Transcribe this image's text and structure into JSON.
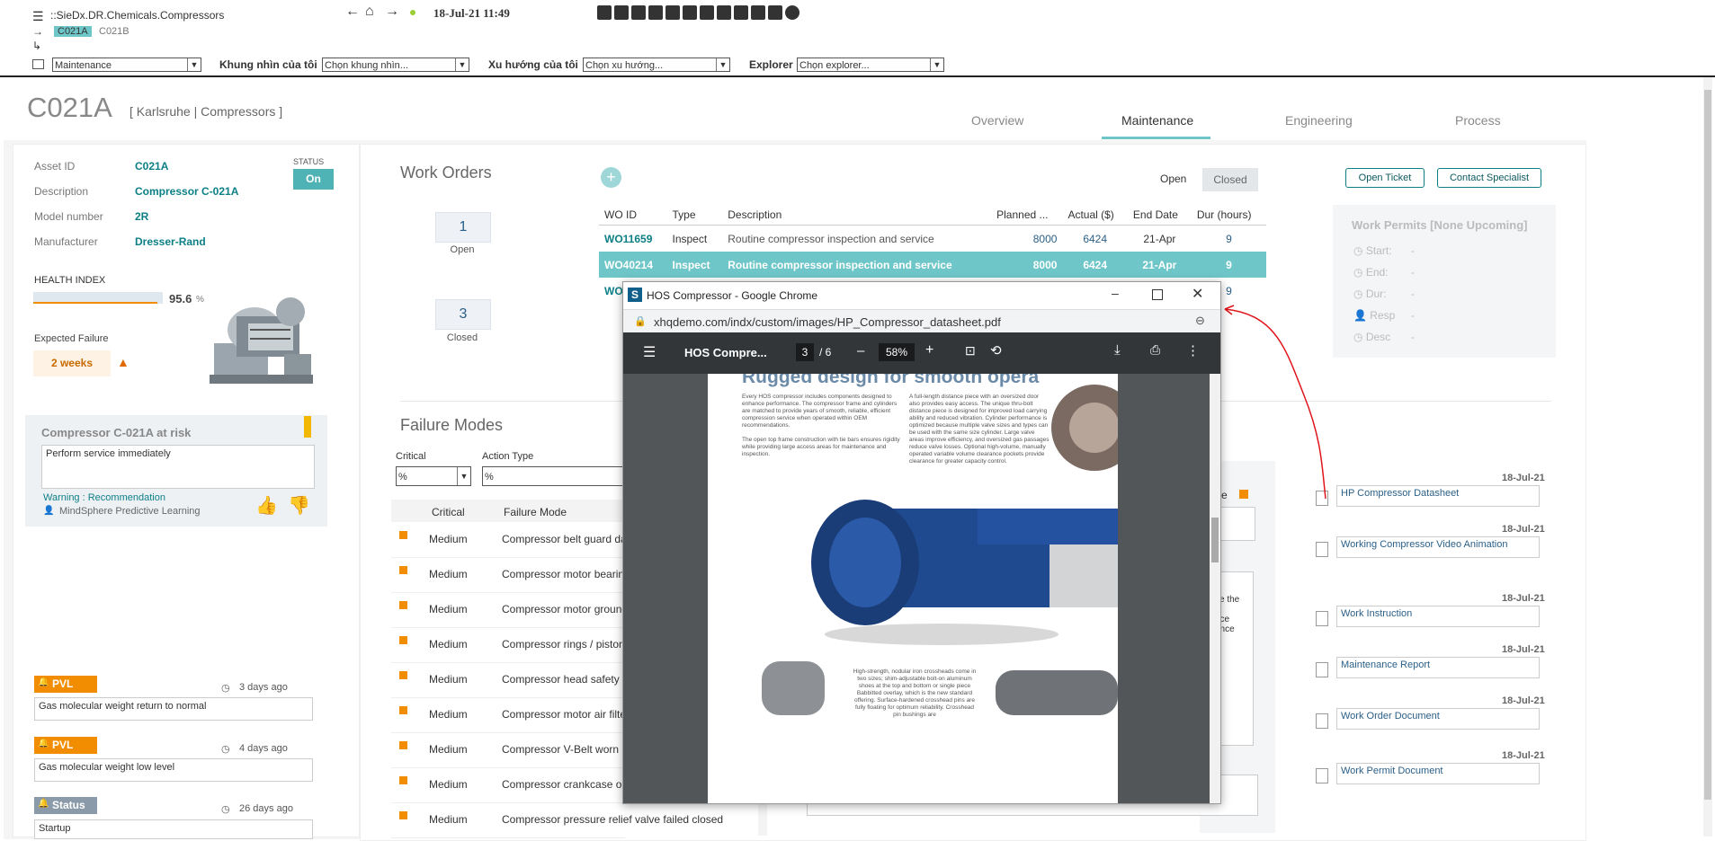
{
  "topbar": {
    "breadcrumb": "::SieDx.DR.Chemicals.Compressors",
    "datetime": "18-Jul-21 11:49",
    "tags": [
      "C021A",
      "C021B"
    ],
    "select1": "Maintenance",
    "label_khung": "Khung nhìn của tôi",
    "select_khung": "Chọn khung nhìn...",
    "label_xuhuong": "Xu hướng của tôi",
    "select_xuhuong": "Chọn xu hướng...",
    "label_explorer": "Explorer",
    "select_explorer": "Chọn explorer..."
  },
  "header": {
    "title": "C021A",
    "subtitle": "[ Karlsruhe | Compressors ]",
    "tabs": [
      "Overview",
      "Maintenance",
      "Engineering",
      "Process"
    ]
  },
  "asset": {
    "labels": [
      "Asset ID",
      "Description",
      "Model number",
      "Manufacturer"
    ],
    "values": [
      "C021A",
      "Compressor C-021A",
      "2R",
      "Dresser-Rand"
    ],
    "status_label": "STATUS",
    "status_value": "On",
    "health_label": "HEALTH INDEX",
    "health_value": "95.6",
    "health_unit": "%",
    "health_fraction": 0.956,
    "expected_label": "Expected Failure",
    "expected_value": "2 weeks"
  },
  "risk": {
    "title": "Compressor C-021A at risk",
    "message": "Perform service immediately",
    "link": "Warning : Recommendation",
    "source": "MindSphere Predictive Learning"
  },
  "alerts": [
    {
      "tag": "PVL",
      "time": "3 days ago",
      "text": "Gas molecular weight return to normal",
      "color": "#f28c00"
    },
    {
      "tag": "PVL",
      "time": "4 days ago",
      "text": "Gas molecular weight low level",
      "color": "#f28c00"
    },
    {
      "tag": "Status",
      "time": "26 days ago",
      "text": "Startup",
      "color": "#8a9aa8"
    }
  ],
  "workorders": {
    "title": "Work Orders",
    "open_count": "1",
    "open_label": "Open",
    "closed_count": "3",
    "closed_label": "Closed",
    "filter_open": "Open",
    "filter_closed": "Closed",
    "columns": [
      "WO ID",
      "Type",
      "Description",
      "Planned ...",
      "Actual ($)",
      "End Date",
      "Dur (hours)"
    ],
    "rows": [
      [
        "WO11659",
        "Inspect",
        "Routine compressor inspection and service",
        "8000",
        "6424",
        "21-Apr",
        "9"
      ],
      [
        "WO40214",
        "Inspect",
        "Routine compressor inspection and service",
        "8000",
        "6424",
        "21-Apr",
        "9"
      ],
      [
        "WO",
        "",
        "",
        "",
        "",
        "",
        "9"
      ]
    ]
  },
  "buttons": {
    "open_ticket": "Open Ticket",
    "contact": "Contact Specialist"
  },
  "permits": {
    "title": "Work Permits [None Upcoming]",
    "fields": [
      "Start:",
      "End:",
      "Dur:",
      "Resp",
      "Desc"
    ],
    "value": "-"
  },
  "failure": {
    "title": "Failure Modes",
    "filter_critical_label": "Critical",
    "filter_action_label": "Action Type",
    "filter_value": "%",
    "col_critical": "Critical",
    "col_mode": "Failure Mode",
    "rows": [
      [
        "Medium",
        "Compressor belt guard da"
      ],
      [
        "Medium",
        "Compressor motor bearing"
      ],
      [
        "Medium",
        "Compressor motor ground"
      ],
      [
        "Medium",
        "Compressor rings / piston"
      ],
      [
        "Medium",
        "Compressor head safety r"
      ],
      [
        "Medium",
        "Compressor motor air filte"
      ],
      [
        "Medium",
        "Compressor V-Belt worn"
      ],
      [
        "Medium",
        "Compressor crankcase oil"
      ],
      [
        "Medium",
        "Compressor pressure relief valve failed closed"
      ]
    ],
    "right_label": "ce",
    "right_frag": [
      "a",
      "ce the",
      "nce",
      "ance",
      "e"
    ]
  },
  "documents": [
    {
      "date": "18-Jul-21",
      "name": "HP Compressor Datasheet"
    },
    {
      "date": "18-Jul-21",
      "name": "Working Compressor Video Animation"
    },
    {
      "date": "18-Jul-21",
      "name": "Work Instruction"
    },
    {
      "date": "18-Jul-21",
      "name": "Maintenance Report"
    },
    {
      "date": "18-Jul-21",
      "name": "Work Order Document"
    },
    {
      "date": "18-Jul-21",
      "name": "Work Permit Document"
    }
  ],
  "chrome": {
    "title": "HOS Compressor - Google Chrome",
    "url": "xhqdemo.com/indx/custom/images/HP_Compressor_datasheet.pdf",
    "pdf_title": "HOS Compre...",
    "page": "3",
    "page_total": "/ 6",
    "zoom": "58%",
    "heading": "Rugged design for smooth opera",
    "col1": "Every HOS compressor includes components designed to enhance performance. The compressor frame and cylinders are matched to provide years of smooth, reliable, efficient compression service when operated within OEM recommendations.",
    "col1b": "The open top frame construction with tie bars ensures rigidity while providing large access areas for maintenance and inspection.",
    "col2": "A full-length distance piece with an oversized door also provides easy access. The unique thru-bolt distance piece is designed for improved load carrying ability and reduced vibration. Cylinder performance is optimized because multiple valve sizes and types can be used with the same size cylinder. Large valve areas improve efficiency, and oversized gas passages reduce valve losses. Optional high-volume, manually operated variable volume clearance pockets provide clearance for greater capacity control.",
    "caption": "High-strength, nodular iron crossheads come in two sizes; shim-adjustable bolt-on aluminum shoes at the top and bottom or single piece Babbitted overlay, which is the new standard offering. Surface-hardened crosshead pins are fully floating for optimum reliability. Crosshead pin bushings are"
  }
}
